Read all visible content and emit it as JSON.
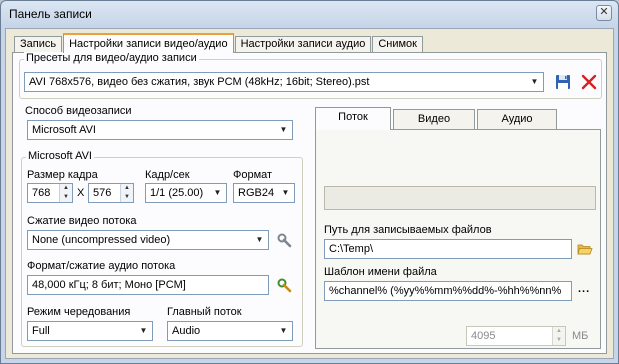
{
  "window": {
    "title": "Панель записи",
    "close": "✕"
  },
  "tabs": [
    "Запись",
    "Настройки записи видео/аудио",
    "Настройки записи аудио",
    "Снимок"
  ],
  "presets": {
    "label": "Пресеты для видео/аудио записи",
    "value": "AVI 768x576, видео без сжатия, звук PCM (48kHz; 16bit; Stereo).pst",
    "save_icon": "save-icon",
    "delete_icon": "delete-icon"
  },
  "capture_method": {
    "label": "Способ видеозаписи",
    "value": "Microsoft AVI"
  },
  "avi": {
    "label": "Microsoft AVI",
    "frame_size_label": "Размер кадра",
    "width": "768",
    "x_sep": "X",
    "height": "576",
    "fps_label": "Кадр/сек",
    "fps_value": "1/1 (25.00)",
    "format_label": "Формат",
    "format_value": "RGB24",
    "video_compression_label": "Сжатие видео потока",
    "video_compression_value": "None (uncompressed video)",
    "audio_label": "Формат/сжатие аудио потока",
    "audio_value": "48,000 кГц; 8 бит; Моно [PCM]",
    "interleave_label": "Режим чередования",
    "interleave_value": "Full",
    "master_label": "Главный поток",
    "master_value": "Audio"
  },
  "right_tabs": [
    "Поток",
    "Видео",
    "Аудио"
  ],
  "right": {
    "path_label": "Путь для записываемых файлов",
    "path_value": "C:\\Temp\\",
    "template_label": "Шаблон имени файла",
    "template_value": "%channel% (%yy%%mm%%dd%-%hh%%nn%",
    "ellipsis": "...",
    "size_value": "4095",
    "size_unit": "МБ"
  }
}
